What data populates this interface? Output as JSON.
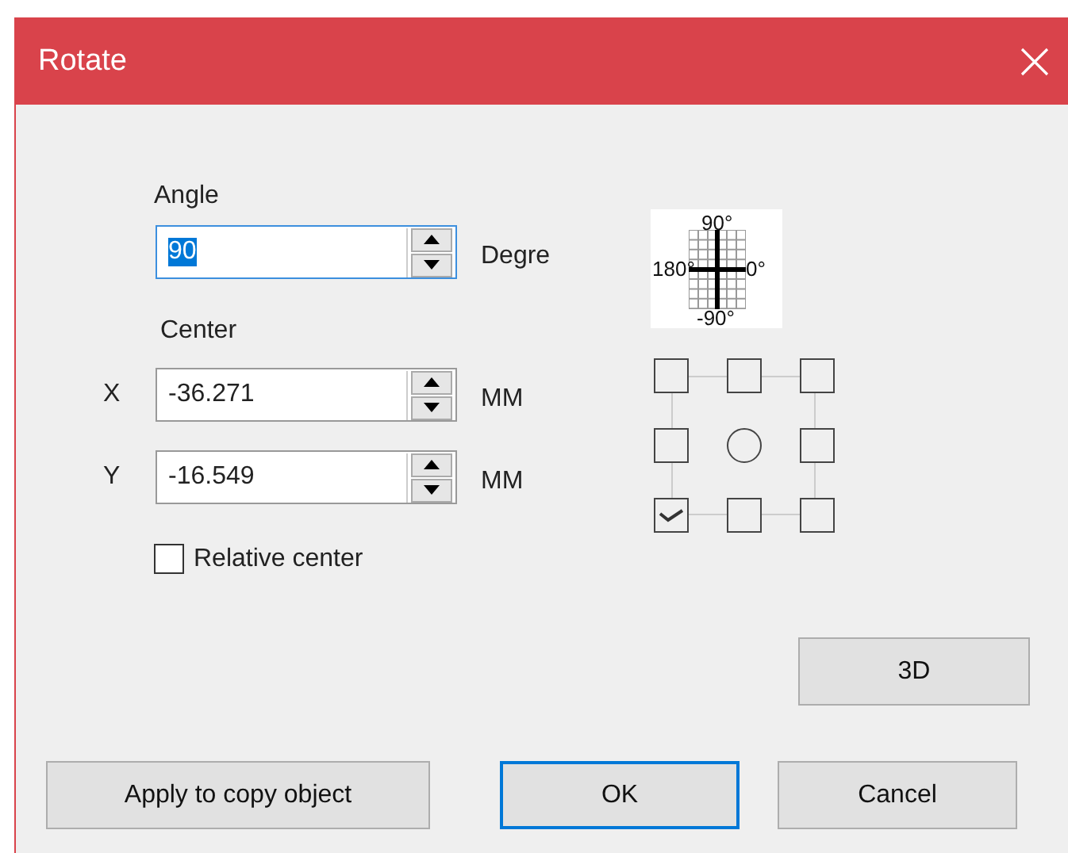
{
  "window": {
    "title": "Rotate"
  },
  "angle": {
    "label": "Angle",
    "value": "90",
    "unit": "Degre",
    "focused": true
  },
  "center": {
    "label": "Center",
    "fields": [
      {
        "axis": "X",
        "value": "-36.271",
        "unit": "MM"
      },
      {
        "axis": "Y",
        "value": "-16.549",
        "unit": "MM"
      }
    ]
  },
  "relative_center": {
    "label": "Relative center",
    "checked": false
  },
  "dial": {
    "top": "90°",
    "left": "180°",
    "right": "0°",
    "bottom": "-90°"
  },
  "anchors": [
    {
      "kind": "box",
      "checked": false
    },
    {
      "kind": "box",
      "checked": false
    },
    {
      "kind": "box",
      "checked": false
    },
    {
      "kind": "box",
      "checked": false
    },
    {
      "kind": "circle",
      "checked": false
    },
    {
      "kind": "box",
      "checked": false
    },
    {
      "kind": "box",
      "checked": true
    },
    {
      "kind": "box",
      "checked": false
    },
    {
      "kind": "box",
      "checked": false
    }
  ],
  "side_button": {
    "label": "3D"
  },
  "buttons": [
    {
      "label": "Apply to copy object",
      "default": false
    },
    {
      "label": "OK",
      "default": true
    },
    {
      "label": "Cancel",
      "default": false
    }
  ]
}
